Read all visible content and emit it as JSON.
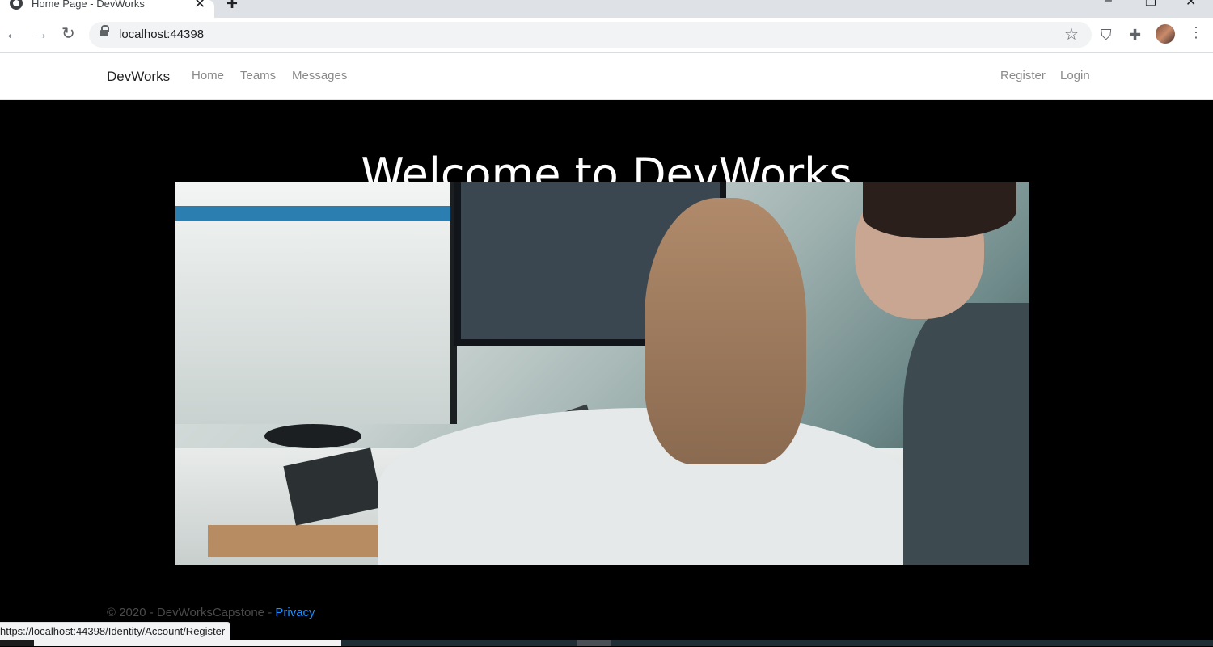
{
  "browser": {
    "tab_title": "Home Page - DevWorks",
    "url": "localhost:44398",
    "status_url": "https://localhost:44398/Identity/Account/Register"
  },
  "navbar": {
    "brand": "DevWorks",
    "links": [
      "Home",
      "Teams",
      "Messages"
    ],
    "right_links": [
      "Register",
      "Login"
    ]
  },
  "main": {
    "heading": "Welcome to DevWorks"
  },
  "footer": {
    "copyright": "© 2020 - DevWorksCapstone - ",
    "privacy": "Privacy"
  },
  "colors": {
    "page_background": "#000000",
    "nav_link": "#8a8a8a",
    "footer_link": "#1e90ff"
  },
  "icons": [
    "globe-icon",
    "close-icon",
    "plus-icon",
    "back-icon",
    "forward-icon",
    "reload-icon",
    "lock-icon",
    "star-icon",
    "shield-icon",
    "puzzle-icon",
    "avatar",
    "menu-icon"
  ]
}
